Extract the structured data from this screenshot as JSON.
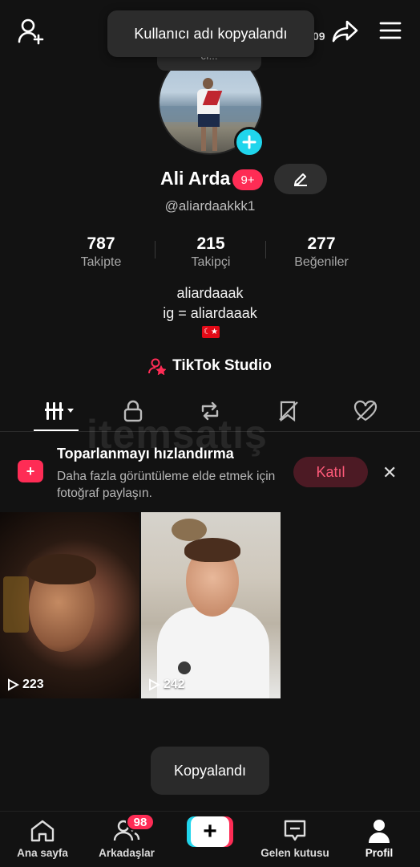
{
  "toast_top": {
    "text": "Kullanıcı adı kopyalandı",
    "tail_text": "cı...",
    "side_count": "09"
  },
  "profile": {
    "name": "Ali Arda",
    "notification_badge": "9+",
    "handle": "@aliardaakkk1"
  },
  "stats": [
    {
      "value": "787",
      "label": "Takipte"
    },
    {
      "value": "215",
      "label": "Takipçi"
    },
    {
      "value": "277",
      "label": "Beğeniler"
    }
  ],
  "bio": {
    "line1": "aliardaaak",
    "line2": "ig = aliardaaak",
    "flag_icon": "turkey-flag"
  },
  "studio": {
    "label": "TikTok Studio"
  },
  "watermark": {
    "text": "itemsatış"
  },
  "promo": {
    "title": "Toparlanmayı hızlandırma",
    "text": "Daha fazla görüntüleme elde etmek için fotoğraf paylaşın.",
    "button": "Katıl"
  },
  "videos": [
    {
      "views": "223"
    },
    {
      "views": "242"
    }
  ],
  "toast_bottom": {
    "text": "Kopyalandı"
  },
  "nav": {
    "home": "Ana sayfa",
    "friends": "Arkadaşlar",
    "friends_badge": "98",
    "inbox": "Gelen kutusu",
    "profile": "Profil"
  },
  "colors": {
    "accent": "#fe2c55",
    "cyan": "#20d5ec",
    "background": "#121212"
  }
}
